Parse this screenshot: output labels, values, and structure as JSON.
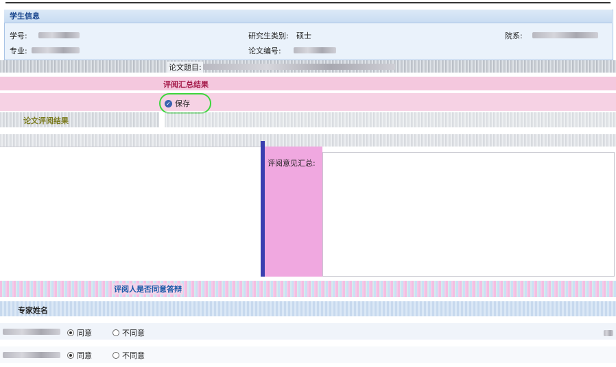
{
  "student_info": {
    "title": "学生信息",
    "student_id_label": "学号:",
    "category_label": "研究生类别:",
    "category_value": "硕士",
    "department_label": "院系:",
    "major_label": "专业:",
    "thesis_no_label": "论文编号:",
    "thesis_title_label": "论文题目:"
  },
  "review_summary": {
    "title": "评阅汇总结果",
    "save_label": "保存",
    "left_section_label": "论文评阅结果",
    "summary_label": "评阅意见汇总:"
  },
  "reviewers": {
    "header": "评阅人是否同意答辩",
    "col_expert": "专家姓名",
    "rows": [
      {
        "agree_label": "同意",
        "disagree_label": "不同意",
        "selected": "agree"
      },
      {
        "agree_label": "同意",
        "disagree_label": "不同意",
        "selected": "agree"
      }
    ]
  },
  "colors": {
    "accent": "#15428b",
    "section_title": "#a61c4c",
    "highlight_ring": "#3cd63c",
    "pink_band": "#f4c8de"
  }
}
